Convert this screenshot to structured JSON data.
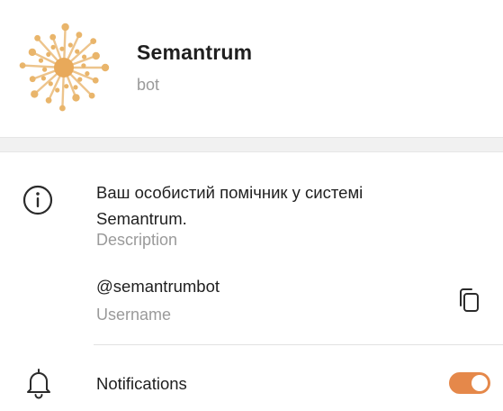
{
  "profile": {
    "name": "Semantrum",
    "subtitle": "bot",
    "avatar_icon": "network-burst-logo",
    "avatar_color": "#e9b56b"
  },
  "info": {
    "description": "Ваш особистий помічник у системі Semantrum.",
    "description_label": "Description",
    "username": "@semantrumbot",
    "username_label": "Username"
  },
  "notifications": {
    "label": "Notifications",
    "enabled": true,
    "toggle_color": "#e5884a"
  },
  "icons": {
    "info": "info-circle-icon",
    "copy": "copy-icon",
    "bell": "bell-icon"
  }
}
